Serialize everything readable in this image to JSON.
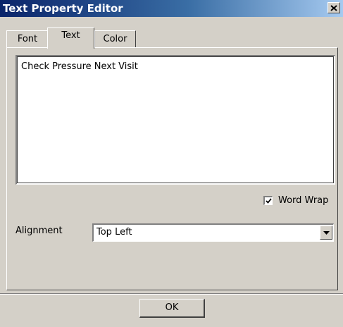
{
  "window": {
    "title": "Text Property Editor"
  },
  "tabs": [
    {
      "label": "Font",
      "active": false
    },
    {
      "label": "Text",
      "active": true
    },
    {
      "label": "Color",
      "active": false
    }
  ],
  "text_panel": {
    "content": "Check Pressure Next Visit",
    "word_wrap": {
      "label": "Word Wrap",
      "checked": true
    },
    "alignment": {
      "label": "Alignment",
      "value": "Top Left"
    }
  },
  "buttons": {
    "ok_label": "OK"
  },
  "icons": {
    "close": "close-icon",
    "check": "checkmark-icon",
    "dropdown": "chevron-down-icon"
  },
  "colors": {
    "face": "#d4d0c8",
    "title_start": "#0a246a",
    "title_end": "#a6caf0"
  }
}
